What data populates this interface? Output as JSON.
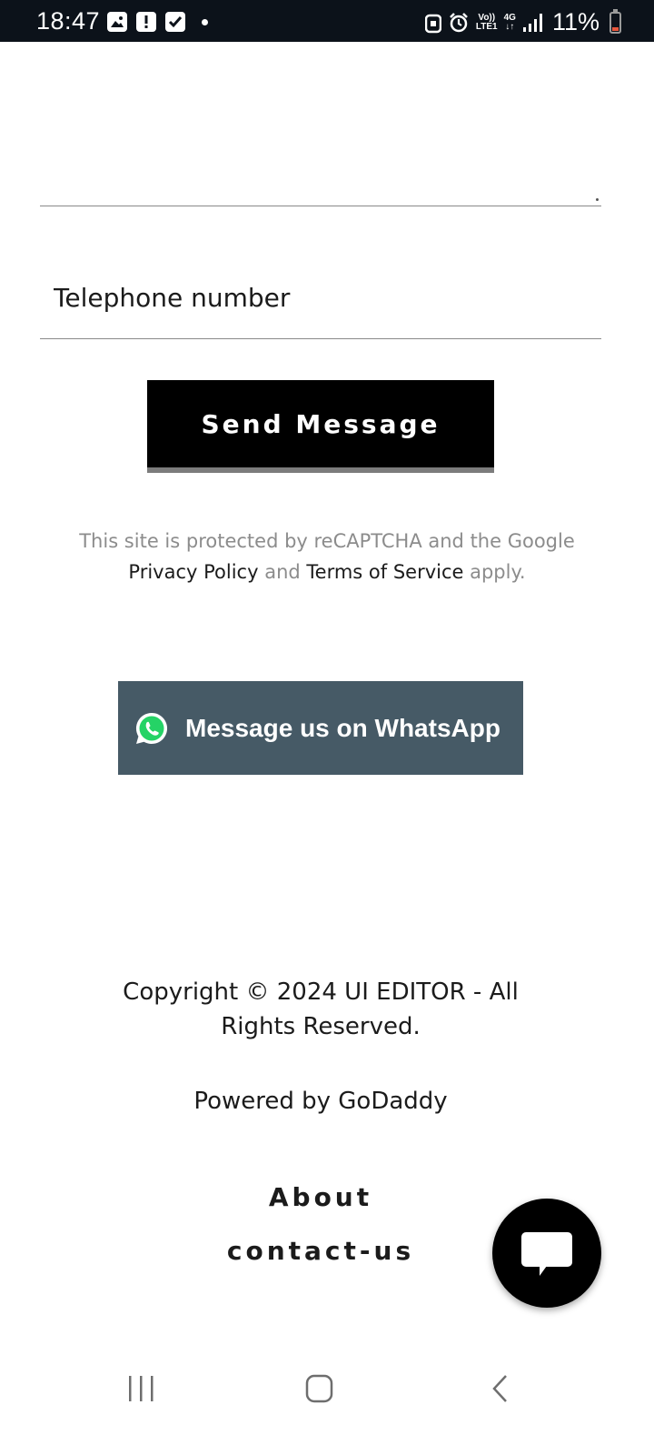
{
  "status_bar": {
    "time": "18:47",
    "volte_line1": "Vo))",
    "volte_line2": "LTE1",
    "network_line1": "4G",
    "network_line2": "↓↑",
    "battery_percent": "11%",
    "battery_color": "#e8573d",
    "icons": [
      "image-icon",
      "alert-icon",
      "checkbox-icon",
      "dot-icon",
      "lock-icon",
      "alarm-icon",
      "signal-icon",
      "battery-icon"
    ]
  },
  "form": {
    "telephone_placeholder": "Telephone number",
    "send_label": "Send Message"
  },
  "recaptcha": {
    "line1": "This site is protected by reCAPTCHA and the Google",
    "privacy_label": "Privacy Policy",
    "and_text": " and ",
    "terms_label": "Terms of Service",
    "apply_text": " apply."
  },
  "whatsapp": {
    "label": "Message us on WhatsApp",
    "button_color": "#465a66",
    "brand_color": "#25d366"
  },
  "footer": {
    "copyright": "Copyright © 2024 UI EDITOR - All Rights Reserved.",
    "powered_prefix": "Powered by ",
    "powered_link": "GoDaddy",
    "links": [
      "About",
      "contact-us"
    ]
  },
  "chat_fab": {
    "icon": "chat-bubble-icon"
  },
  "nav_bar": {
    "buttons": [
      "recents-icon",
      "home-icon",
      "back-icon"
    ]
  }
}
